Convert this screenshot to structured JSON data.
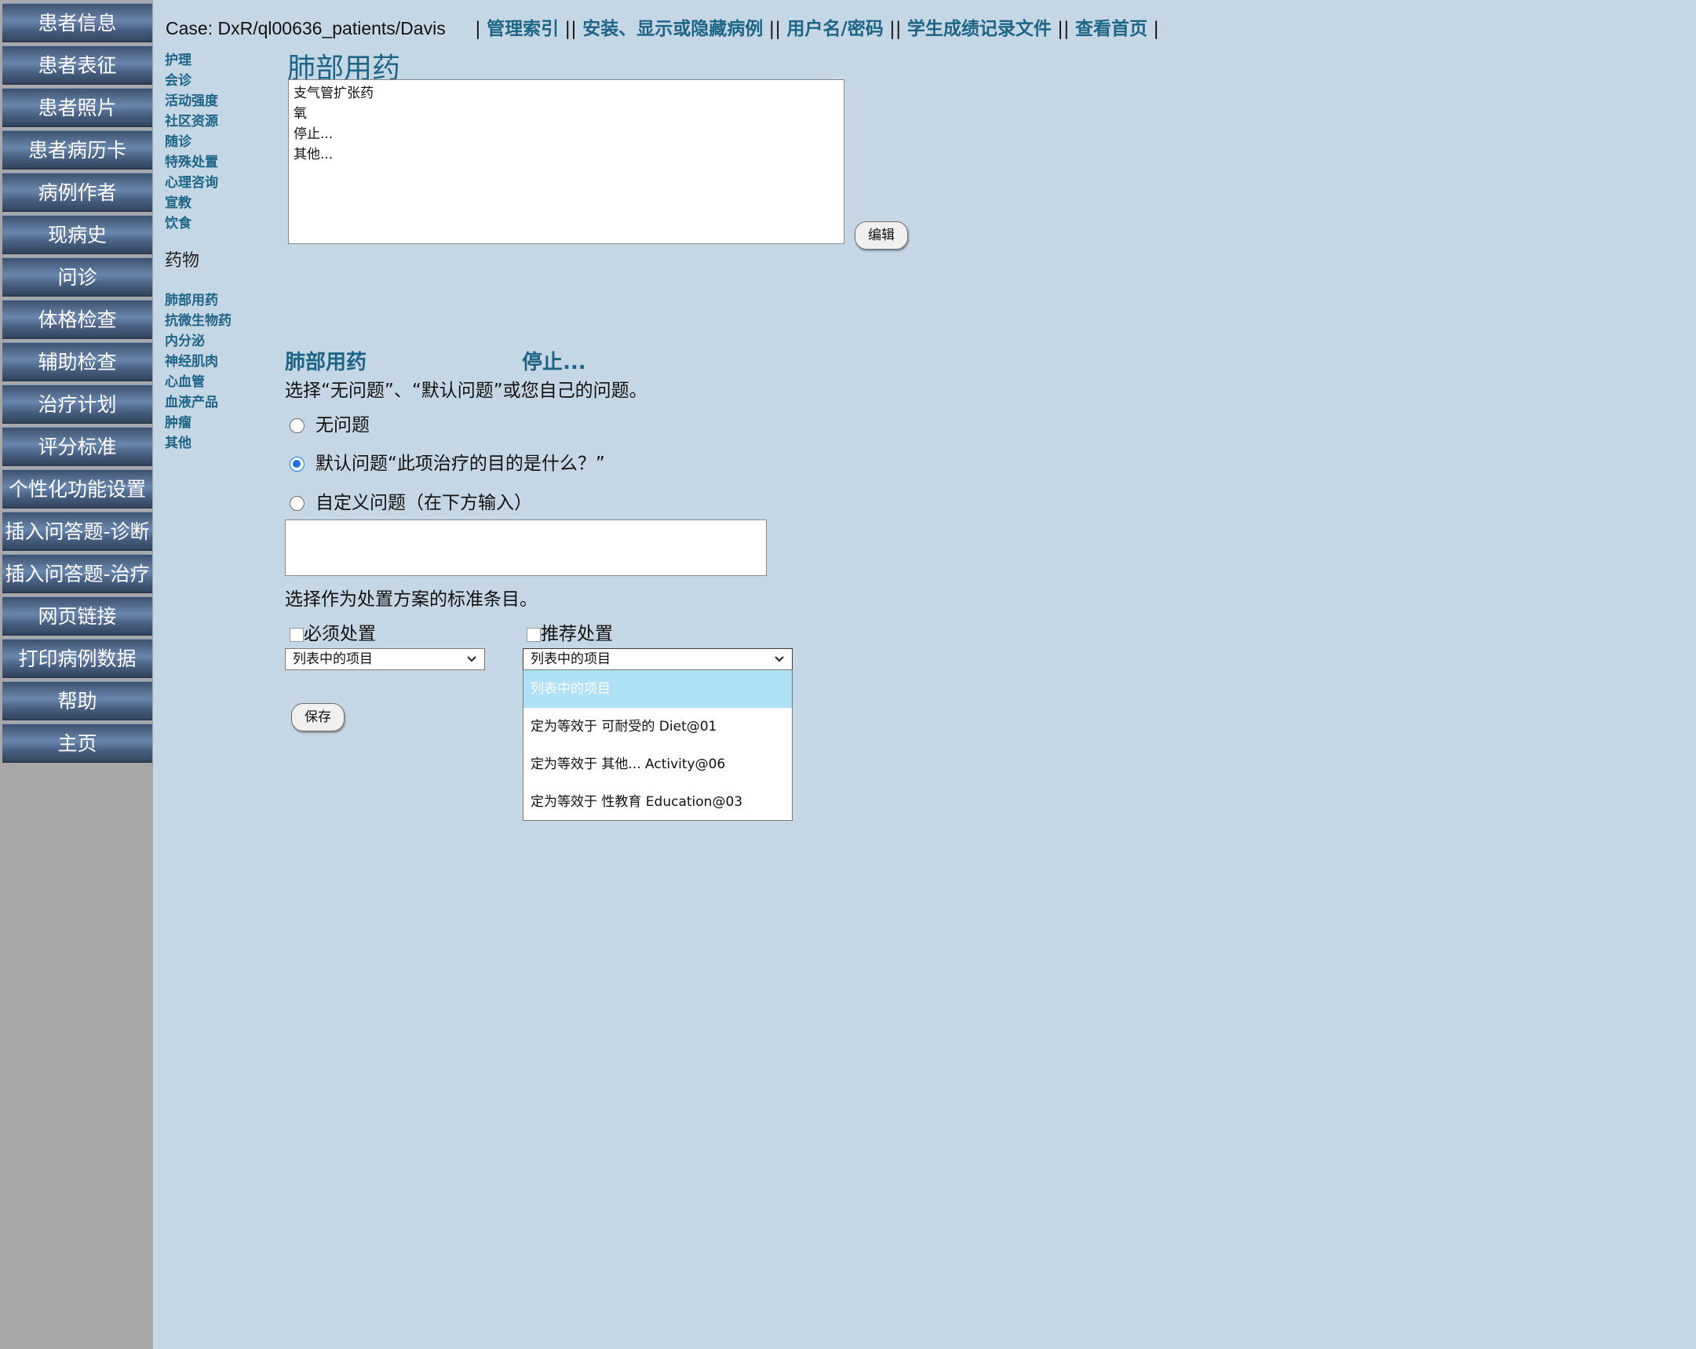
{
  "case_label": "Case: DxR/ql00636_patients/Davis",
  "top_links": [
    "管理索引",
    "安装、显示或隐藏病例",
    "用户名/密码",
    "学生成绩记录文件",
    "查看首页"
  ],
  "left_nav": [
    "患者信息",
    "患者表征",
    "患者照片",
    "患者病历卡",
    "病例作者",
    "现病史",
    "问诊",
    "体格检查",
    "辅助检查",
    "治疗计划",
    "评分标准",
    "个性化功能设置",
    "插入问答题-诊断",
    "插入问答题-治疗",
    "网页链接",
    "打印病例数据",
    "帮助",
    "主页"
  ],
  "sub_nav": {
    "links_a": [
      "护理",
      "会诊",
      "活动强度",
      "社区资源",
      "随诊",
      "特殊处置",
      "心理咨询",
      "宣教",
      "饮食"
    ],
    "group_title": "药物",
    "links_b": [
      "肺部用药",
      "抗微生物药",
      "内分泌",
      "神经肌肉",
      "心血管",
      "血液产品",
      "肿瘤",
      "其他"
    ]
  },
  "page_title": "肺部用药",
  "listbox_options": [
    "支气管扩张药",
    "氧",
    "停止...",
    "其他..."
  ],
  "edit_label": "编辑",
  "section_left": "肺部用药",
  "section_right": "停止...",
  "instruction_question": "选择“无问题”、“默认问题”或您自己的问题。",
  "radios": [
    {
      "label": "无问题",
      "checked": false
    },
    {
      "label": "默认问题“此项治疗的目的是什么？”",
      "checked": true
    },
    {
      "label": "自定义问题（在下方输入）",
      "checked": false
    }
  ],
  "custom_question_value": "",
  "instruction_criteria": "选择作为处置方案的标准条目。",
  "required_label": "必须处置",
  "recommended_label": "推荐处置",
  "select_required_value": "列表中的项目",
  "select_recommended_value": "列表中的项目",
  "dropdown_options": [
    "列表中的项目",
    "定为等效于 可耐受的 Diet@01",
    "定为等效于 其他... Activity@06",
    "定为等效于 性教育 Education@03"
  ],
  "dropdown_highlighted_index": 0,
  "save_label": "保存",
  "colors": {
    "background": "#c5d7e5",
    "link": "#1d6587",
    "nav_sidebar": "#a8a8a8",
    "highlight": "#aee0f6"
  }
}
